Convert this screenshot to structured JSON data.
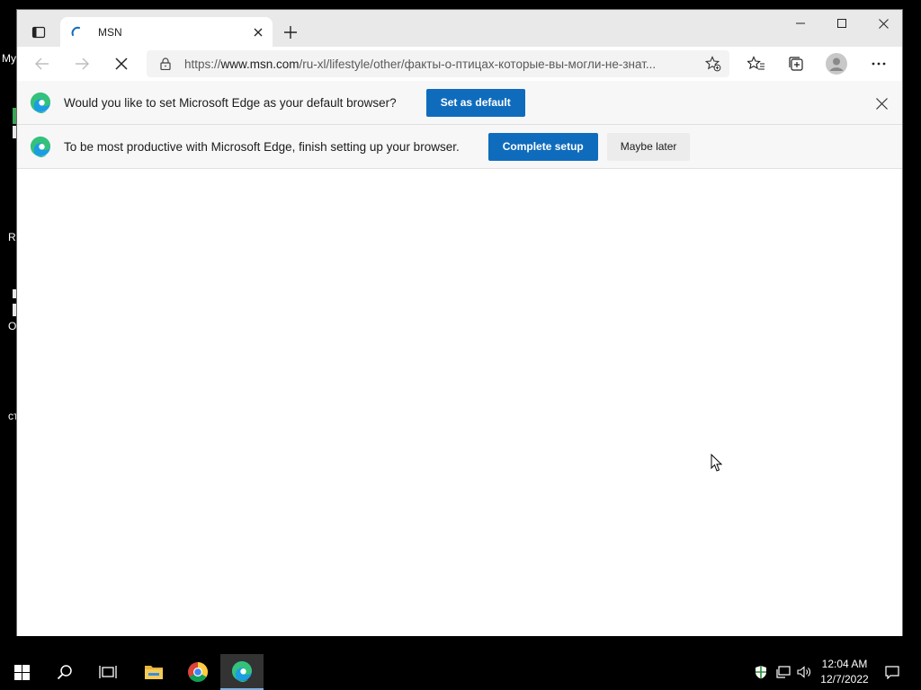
{
  "desktop": {
    "fragments": [
      "My",
      "R",
      "O",
      "ст"
    ]
  },
  "browser": {
    "tab": {
      "title": "MSN"
    },
    "address": {
      "scheme": "https://",
      "host": "www.msn.com",
      "path": "/ru-xl/lifestyle/other/факты-о-птицах-которые-вы-могли-не-знат..."
    },
    "infobar_default": {
      "message": "Would you like to set Microsoft Edge as your default browser?",
      "button": "Set as default"
    },
    "infobar_setup": {
      "message": "To be most productive with Microsoft Edge, finish setting up your browser.",
      "primary_button": "Complete setup",
      "secondary_button": "Maybe later"
    }
  },
  "taskbar": {
    "time": "12:04 AM",
    "date": "12/7/2022"
  },
  "colors": {
    "accent": "#0f6cbd",
    "titlebar": "#e9e9e9",
    "infobar": "#f7f7f7"
  }
}
